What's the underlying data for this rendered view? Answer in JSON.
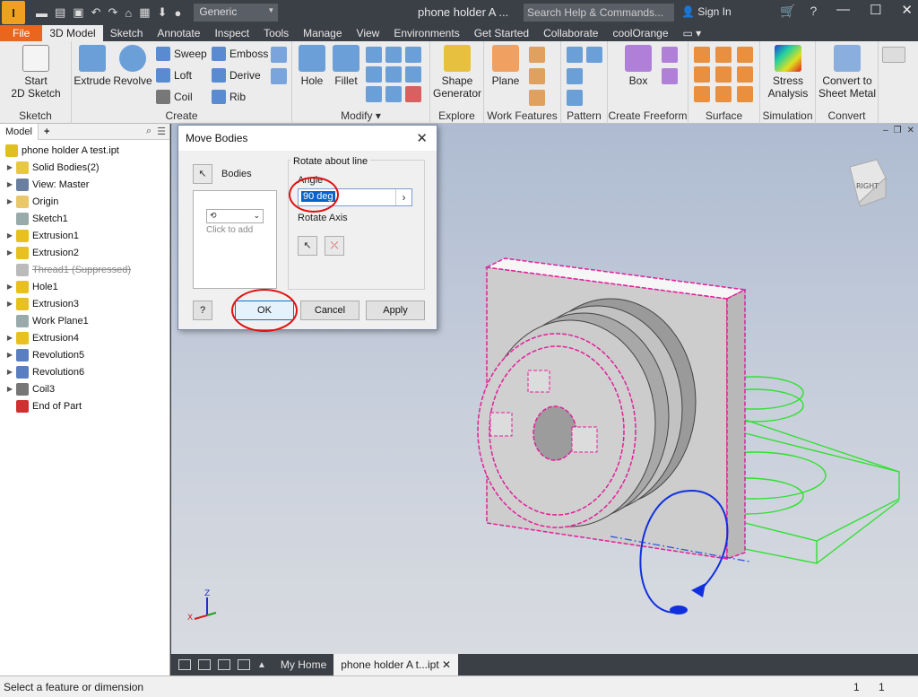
{
  "titlebar": {
    "logo": "I",
    "profile": "Generic",
    "document_title": "phone holder A ...",
    "help_search_placeholder": "Search Help & Commands...",
    "sign_in": "Sign In"
  },
  "ribbon_tabs": [
    "File",
    "3D Model",
    "Sketch",
    "Annotate",
    "Inspect",
    "Tools",
    "Manage",
    "View",
    "Environments",
    "Get Started",
    "Collaborate",
    "coolOrange"
  ],
  "active_tab": "3D Model",
  "ribbon": {
    "sketch": {
      "label": "Sketch",
      "start_sketch": "Start",
      "start_sketch_2": "2D Sketch"
    },
    "create": {
      "label": "Create",
      "extrude": "Extrude",
      "revolve": "Revolve",
      "sweep": "Sweep",
      "loft": "Loft",
      "coil": "Coil",
      "emboss": "Emboss",
      "derive": "Derive",
      "rib": "Rib"
    },
    "modify": {
      "label": "Modify",
      "hole": "Hole",
      "fillet": "Fillet"
    },
    "explore": {
      "label": "Explore",
      "shape_generator": "Shape",
      "shape_generator_2": "Generator"
    },
    "work_features": {
      "label": "Work Features",
      "plane": "Plane"
    },
    "pattern": {
      "label": "Pattern"
    },
    "create_freeform": {
      "label": "Create Freeform",
      "box": "Box"
    },
    "surface": {
      "label": "Surface"
    },
    "simulation": {
      "label": "Simulation",
      "stress": "Stress",
      "stress_2": "Analysis"
    },
    "convert": {
      "label": "Convert",
      "convert_sm": "Convert to",
      "convert_sm_2": "Sheet Metal"
    }
  },
  "browser": {
    "tab": "Model",
    "items": [
      {
        "label": "phone holder A test.ipt",
        "level": 0,
        "arrow": false,
        "color": "#e0c020"
      },
      {
        "label": "Solid Bodies(2)",
        "level": 1,
        "arrow": true,
        "color": "#e8c840"
      },
      {
        "label": "View: Master",
        "level": 1,
        "arrow": true,
        "color": "#6a7fa0"
      },
      {
        "label": "Origin",
        "level": 1,
        "arrow": true,
        "color": "#e8c86a"
      },
      {
        "label": "Sketch1",
        "level": 1,
        "arrow": false,
        "color": "#9aa"
      },
      {
        "label": "Extrusion1",
        "level": 1,
        "arrow": true,
        "color": "#e8c020"
      },
      {
        "label": "Extrusion2",
        "level": 1,
        "arrow": true,
        "color": "#e8c020"
      },
      {
        "label": "Thread1 (Suppressed)",
        "level": 1,
        "arrow": false,
        "color": "#bbb",
        "suppressed": true
      },
      {
        "label": "Hole1",
        "level": 1,
        "arrow": true,
        "color": "#e8c020"
      },
      {
        "label": "Extrusion3",
        "level": 1,
        "arrow": true,
        "color": "#e8c020"
      },
      {
        "label": "Work Plane1",
        "level": 1,
        "arrow": false,
        "color": "#9aa"
      },
      {
        "label": "Extrusion4",
        "level": 1,
        "arrow": true,
        "color": "#e8c020"
      },
      {
        "label": "Revolution5",
        "level": 1,
        "arrow": true,
        "color": "#5a7fc0"
      },
      {
        "label": "Revolution6",
        "level": 1,
        "arrow": true,
        "color": "#5a7fc0"
      },
      {
        "label": "Coil3",
        "level": 1,
        "arrow": true,
        "color": "#777"
      },
      {
        "label": "End of Part",
        "level": 1,
        "arrow": false,
        "color": "#d03030"
      }
    ]
  },
  "dialog": {
    "title": "Move Bodies",
    "bodies_label": "Bodies",
    "click_to_add": "Click to add",
    "group_title": "Rotate about line",
    "angle_label": "Angle",
    "angle_value": "90 deg",
    "rotate_axis_label": "Rotate Axis",
    "ok": "OK",
    "cancel": "Cancel",
    "apply": "Apply",
    "help": "?"
  },
  "viewcube_label": "RIGHT",
  "doc_tabs": {
    "home": "My Home",
    "active": "phone holder A t...ipt"
  },
  "status": {
    "message": "Select a feature or dimension",
    "count1": "1",
    "count2": "1"
  },
  "colors": {
    "file_tab": "#e8661e",
    "selection_magenta": "#e0209a",
    "sketch_green": "#30e030",
    "annotation_red": "#e01010"
  }
}
